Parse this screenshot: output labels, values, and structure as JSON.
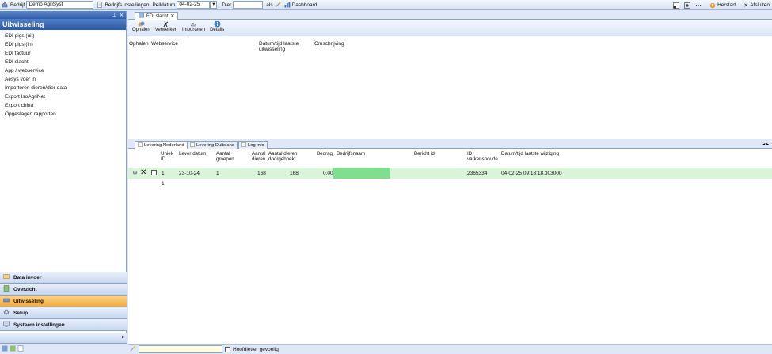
{
  "topbar": {
    "bedrijf_label": "Bedrijf",
    "bedrijf_value": "Demo AgriSyst",
    "bedrijfs_instellingen": "Bedrijfs instellingen",
    "peildatum_label": "Peildatum",
    "peildatum_value": "04-02-25",
    "dier_label": "Dier",
    "dier_value": "",
    "als_label": "als",
    "dashboard": "Dashboard",
    "herstart": "Herstart",
    "afsluiten": "Afsluiten"
  },
  "sidebar": {
    "title": "Uitwisseling",
    "items": [
      {
        "label": "EDI pigs (uit)"
      },
      {
        "label": "EDI pigs (in)"
      },
      {
        "label": "EDI factuur"
      },
      {
        "label": "EDI slacht"
      },
      {
        "label": "App / webservice"
      },
      {
        "label": "Aesys voer in"
      },
      {
        "label": "Importeren dieren/dier data"
      },
      {
        "label": "Export IsoAgriNet"
      },
      {
        "label": "Export china"
      },
      {
        "label": "Opgeslagen rapporten"
      }
    ],
    "nav": [
      {
        "label": "Data invoer"
      },
      {
        "label": "Overzicht"
      },
      {
        "label": "Uitwisseling"
      },
      {
        "label": "Setup"
      },
      {
        "label": "Systeem instellingen"
      }
    ]
  },
  "main": {
    "doc_tab": "EDI slacht",
    "ribbon": [
      "Ophalen",
      "Verwerken",
      "Importeren",
      "Details"
    ],
    "upper_headers": {
      "ophalen": "Ophalen",
      "webservice": "Webservice",
      "datum1": "Datum/tijd laatste",
      "datum2": "uitwisseling",
      "omschrijving": "Omschrijving"
    },
    "tabs": [
      "Levering Nederland",
      "Levering Duitsland",
      "Log info"
    ],
    "grid_headers": {
      "uniek1": "Uniek",
      "uniek2": "ID",
      "lever_datum": "Lever datum",
      "aantal_groepen1": "Aantal",
      "aantal_groepen2": "groepen",
      "aantal_dieren1": "Aantal",
      "aantal_dieren2": "dieren",
      "doorgeboekt1": "Aantal dieren",
      "doorgeboekt2": "doorgeboekt",
      "bedrag": "Bedrag",
      "bedrijfsnaam": "Bedrijfsnaam",
      "bericht_id": "Bericht id",
      "varkenshouder1": "ID",
      "varkenshouder2": "varkenshoude",
      "laatste_wijziging": "Datum/tijd laatste wijziging"
    },
    "rows": [
      {
        "uniek_id": "1",
        "lever_datum": "23-10-24",
        "aantal_groepen": "1",
        "aantal_dieren": "168",
        "doorgeboekt": "168",
        "bedrag": "0,00",
        "bedrijfsnaam": "",
        "bericht_id": "",
        "varkenshouder": "2365334",
        "laatste_wijziging": "04-02-25 09:18:18.303000"
      }
    ],
    "detail_row_value": "1",
    "status": {
      "hoofdletter_label": "Hoofdletter gevoelig"
    }
  }
}
